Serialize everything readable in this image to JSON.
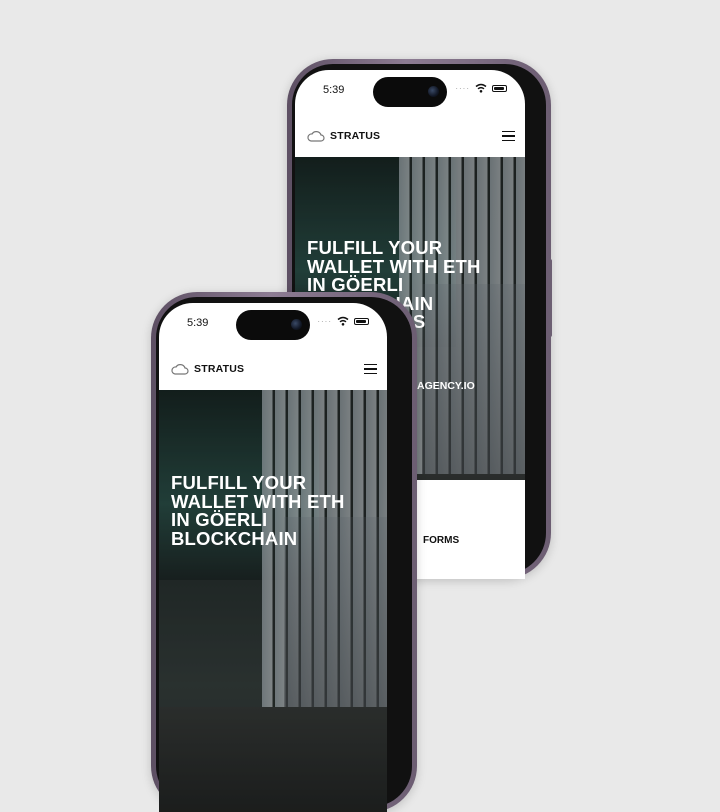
{
  "devices": [
    {
      "time": "5:39",
      "brand": "STRATUS",
      "hero_title": "FULFILL YOUR\nWALLET WITH ETH\nIN GÖERLI\nBLOCKCHAIN\nIN 24 HOURS",
      "hero_link": "AGENCY.IO",
      "cta_fragment": "FORMS"
    },
    {
      "time": "5:39",
      "brand": "STRATUS",
      "hero_title": "FULFILL YOUR\nWALLET WITH ETH\nIN GÖERLI\nBLOCKCHAIN"
    }
  ],
  "icons": {
    "logo": "cloud-icon",
    "menu": "hamburger-menu-icon",
    "camera": "front-camera-icon",
    "signal": "cellular-dots-icon",
    "wifi": "wifi-icon",
    "battery": "battery-icon"
  },
  "colors": {
    "background": "#e9e9e9",
    "phone_frame": "#8d7c93",
    "text_light": "#ffffff",
    "text_dark": "#111111"
  }
}
